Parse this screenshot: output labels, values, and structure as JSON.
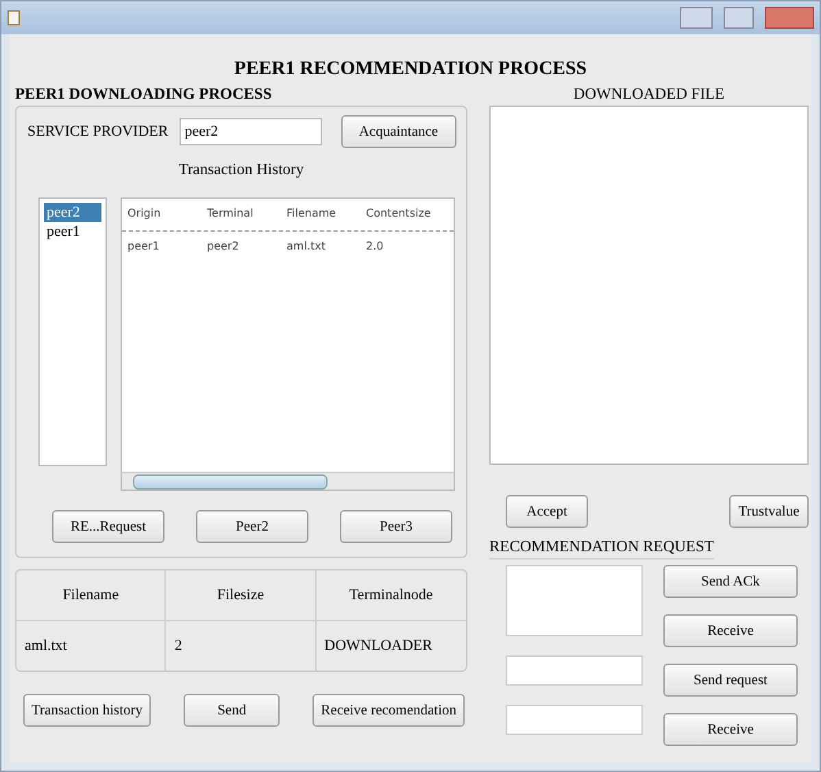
{
  "window": {
    "heading": "PEER1   RECOMMENDATION PROCESS"
  },
  "downloading": {
    "title": "PEER1 DOWNLOADING PROCESS",
    "provider_label": "SERVICE PROVIDER",
    "provider_value": "peer2",
    "acquaintance_button": "Acquaintance",
    "history_label": "Transaction History",
    "peers": [
      {
        "label": "peer2",
        "selected": true
      },
      {
        "label": "peer1",
        "selected": false
      }
    ],
    "history_columns": [
      "Origin",
      "Terminal",
      "Filename",
      "Contentsize"
    ],
    "history_rows": [
      [
        "peer1",
        "peer2",
        "aml.txt",
        "2.0"
      ]
    ],
    "buttons": [
      "RE...Request",
      "Peer2",
      "Peer3"
    ]
  },
  "files_table": {
    "columns": [
      "Filename",
      "Filesize",
      "Terminalnode"
    ],
    "rows": [
      [
        "aml.txt",
        "2",
        "DOWNLOADER"
      ]
    ]
  },
  "bottom_buttons": [
    "Transaction history",
    "Send",
    "Receive recomendation"
  ],
  "downloaded_file": {
    "title": "DOWNLOADED FILE"
  },
  "file_buttons": [
    "Accept",
    "Trustvalue"
  ],
  "recommendation": {
    "title": "RECOMMENDATION REQUEST",
    "buttons": [
      "Send ACk",
      "Receive",
      "Send request",
      "Receive"
    ]
  }
}
